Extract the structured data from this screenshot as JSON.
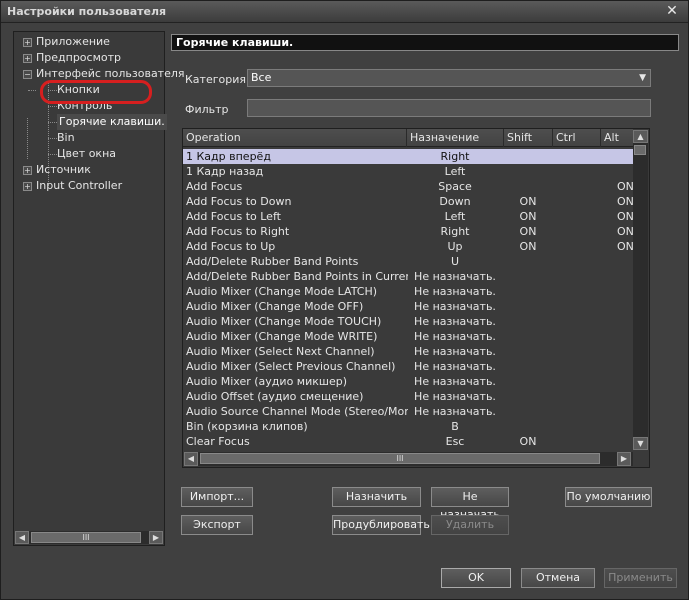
{
  "window": {
    "title": "Настройки пользователя",
    "close_glyph": "✕"
  },
  "tree": {
    "items": [
      {
        "label": "Приложение",
        "expander": "+"
      },
      {
        "label": "Предпросмотр",
        "expander": "+"
      },
      {
        "label": "Интерфейс пользователя",
        "expander": "−"
      },
      {
        "label": "Кнопки"
      },
      {
        "label": "Контроль"
      },
      {
        "label": "Горячие клавиши."
      },
      {
        "label": "Bin"
      },
      {
        "label": "Цвет окна"
      },
      {
        "label": "Источник",
        "expander": "+"
      },
      {
        "label": "Input Controller",
        "expander": "+"
      }
    ],
    "scroll_left": "◀",
    "scroll_right": "▶",
    "thumb_grip": "III"
  },
  "panel": {
    "title": "Горячие клавиши.",
    "category_label": "Категория",
    "category_value": "Все",
    "filter_label": "Фильтр",
    "filter_value": ""
  },
  "grid": {
    "columns": [
      "Operation",
      "Назначение",
      "Shift",
      "Ctrl",
      "Alt"
    ],
    "rows": [
      [
        "1 Кадр вперёд",
        "Right",
        "",
        "",
        ""
      ],
      [
        "1 Кадр назад",
        "Left",
        "",
        "",
        ""
      ],
      [
        "Add Focus",
        "Space",
        "",
        "",
        "ON"
      ],
      [
        "Add Focus to Down",
        "Down",
        "ON",
        "",
        "ON"
      ],
      [
        "Add Focus to Left",
        "Left",
        "ON",
        "",
        "ON"
      ],
      [
        "Add Focus to Right",
        "Right",
        "ON",
        "",
        "ON"
      ],
      [
        "Add Focus to Up",
        "Up",
        "ON",
        "",
        "ON"
      ],
      [
        "Add/Delete Rubber Band Points",
        "U",
        "",
        "",
        ""
      ],
      [
        "Add/Delete Rubber Band Points in Current ...",
        "Не назначать.",
        "",
        "",
        ""
      ],
      [
        "Audio Mixer (Change Mode LATCH)",
        "Не назначать.",
        "",
        "",
        ""
      ],
      [
        "Audio Mixer (Change Mode OFF)",
        "Не назначать.",
        "",
        "",
        ""
      ],
      [
        "Audio Mixer (Change Mode TOUCH)",
        "Не назначать.",
        "",
        "",
        ""
      ],
      [
        "Audio Mixer (Change Mode WRITE)",
        "Не назначать.",
        "",
        "",
        ""
      ],
      [
        "Audio Mixer (Select Next Channel)",
        "Не назначать.",
        "",
        "",
        ""
      ],
      [
        "Audio Mixer (Select Previous Channel)",
        "Не назначать.",
        "",
        "",
        ""
      ],
      [
        "Audio Mixer (аудио микшер)",
        "Не назначать.",
        "",
        "",
        ""
      ],
      [
        "Audio Offset (аудио смещение)",
        "Не назначать.",
        "",
        "",
        ""
      ],
      [
        "Audio Source Channel Mode (Stereo/Monoral)",
        "Не назначать.",
        "",
        "",
        ""
      ],
      [
        "Bin (корзина клипов)",
        "B",
        "",
        "",
        ""
      ],
      [
        "Clear Focus",
        "Esc",
        "ON",
        "",
        ""
      ]
    ],
    "selected_row": 0,
    "scroll_up": "▲",
    "scroll_down": "▼",
    "scroll_left": "◀",
    "scroll_right": "▶",
    "thumb_grip": "III"
  },
  "buttons": {
    "import": "Импорт...",
    "export": "Экспорт",
    "assign": "Назначить",
    "unassign": "Не назначать",
    "duplicate": "Продублировать",
    "delete": "Удалить",
    "defaults": "По умолчанию",
    "ok": "OK",
    "cancel": "Отмена",
    "apply": "Применить"
  }
}
